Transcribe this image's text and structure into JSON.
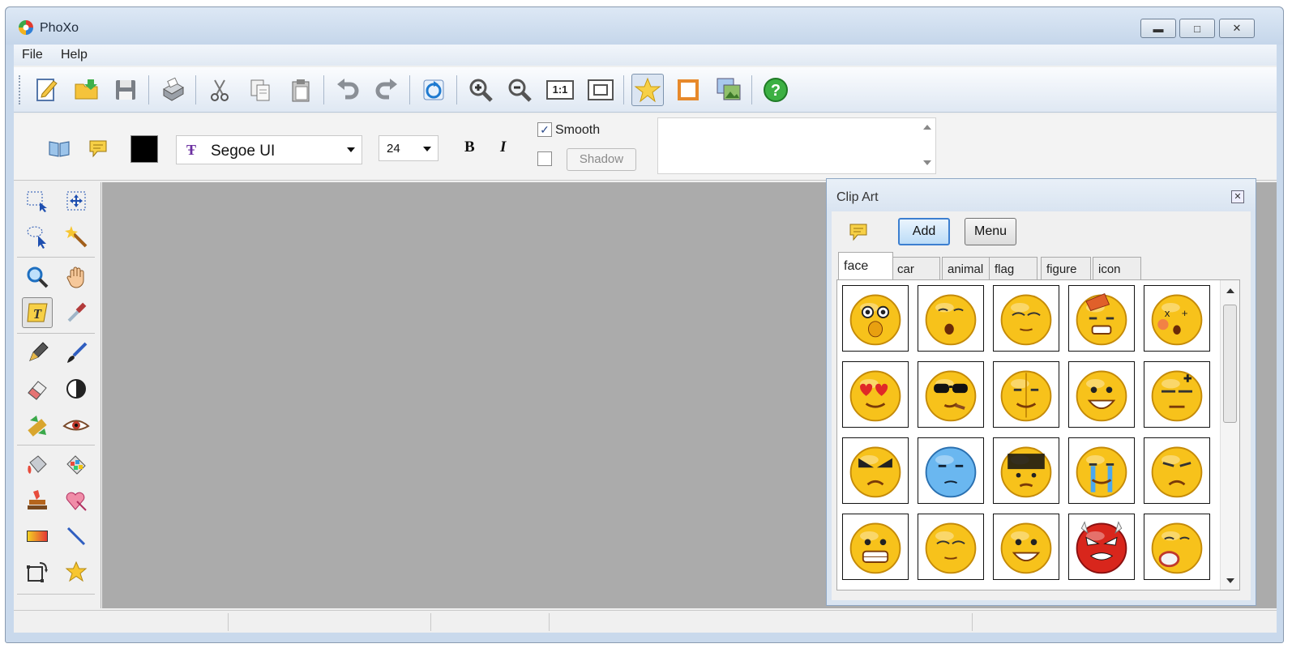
{
  "window": {
    "title": "PhoXo"
  },
  "menu": {
    "file": "File",
    "help": "Help"
  },
  "toolbar": {
    "icons": [
      "new-icon",
      "open-icon",
      "save-icon",
      "print-icon",
      "cut-icon",
      "copy-icon",
      "paste-icon",
      "undo-icon",
      "redo-icon",
      "refresh-icon",
      "zoom-in-icon",
      "zoom-out-icon",
      "actual-size-icon",
      "fit-window-icon",
      "clipart-star-icon",
      "frame-icon",
      "gallery-icon",
      "help-icon"
    ],
    "actual_size_label": "1:1"
  },
  "text_toolbar": {
    "font_name": "Segoe UI",
    "font_size": "24",
    "bold_label": "B",
    "italic_label": "I",
    "smooth_label": "Smooth",
    "smooth_checked": true,
    "shadow_checked": false,
    "shadow_label": "Shadow",
    "text_color": "#000000"
  },
  "clipart": {
    "title": "Clip Art",
    "add_label": "Add",
    "menu_label": "Menu",
    "tabs": [
      "face",
      "car",
      "animal",
      "flag",
      "figure",
      "icon"
    ],
    "selected_tab": "face"
  },
  "colors": {
    "canvas_bg": "#ababab",
    "accent": "#3c7fd0"
  }
}
